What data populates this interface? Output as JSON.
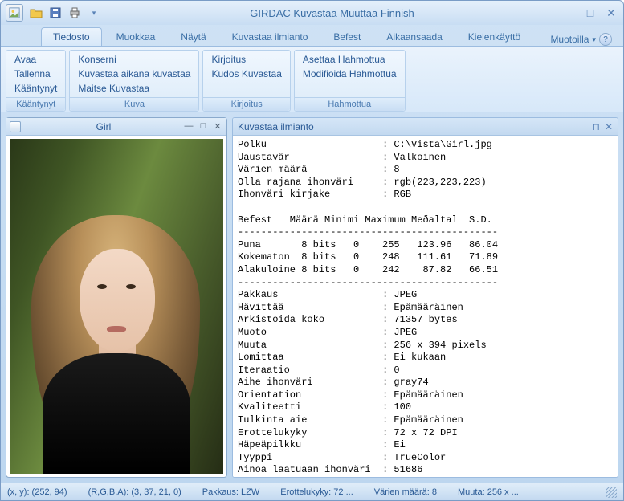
{
  "title": "GIRDAC Kuvastaa Muuttaa Finnish",
  "tabs": {
    "tiedosto": "Tiedosto",
    "muokkaa": "Muokkaa",
    "nayta": "Näytä",
    "kuvastaa_ilmianto": "Kuvastaa ilmianto",
    "befest": "Befest",
    "aikaansaada": "Aikaansaada",
    "kielenkaytto": "Kielenkäyttö",
    "muotoilla": "Muotoilla"
  },
  "ribbon": {
    "group1": {
      "items": [
        "Avaa",
        "Tallenna",
        "Kääntynyt"
      ],
      "label": "Kääntynyt"
    },
    "group2": {
      "items": [
        "Konserni",
        "Kuvastaa aikana kuvastaa",
        "Maitse Kuvastaa"
      ],
      "label": "Kuva"
    },
    "group3": {
      "items": [
        "Kirjoitus",
        "Kudos Kuvastaa"
      ],
      "label": "Kirjoitus"
    },
    "group4": {
      "items": [
        "Asettaa Hahmottua",
        "Modifioida Hahmottua"
      ],
      "label": "Hahmottua"
    }
  },
  "mdi": {
    "title": "Girl"
  },
  "panel": {
    "title": "Kuvastaa ilmianto",
    "text": "Polku                    : C:\\Vista\\Girl.jpg\nUaustavär                : Valkoinen\nVärien määrä             : 8\nOlla rajana ihonväri     : rgb(223,223,223)\nIhonväri kirjake         : RGB\n\nBefest   Määrä Minimi Maximum Meðaltal  S.D.\n---------------------------------------------\nPuna       8 bits   0    255   123.96   86.04\nKokematon  8 bits   0    248   111.61   71.89\nAlakuloine 8 bits   0    242    87.82   66.51\n---------------------------------------------\nPakkaus                  : JPEG\nHävittää                 : Epämääräinen\nArkistoida koko          : 71357 bytes\nMuoto                    : JPEG\nMuuta                    : 256 x 394 pixels\nLomittaa                 : Ei kukaan\nIteraatio                : 0\nAihe ihonväri            : gray74\nOrientation              : Epämääräinen\nKvaliteetti              : 100\nTulkinta aie             : Epämääräinen\nErottelukyky             : 72 x 72 DPI\nHäpeäpilkku              : Ei\nTyyppi                   : TrueColor\nAinoa laatuaan ihonväri  : 51686"
  },
  "status": {
    "xy": "(x, y): (252, 94)",
    "rgba": "(R,G,B,A): (3, 37, 21, 0)",
    "pakkaus": "Pakkaus: LZW",
    "erottelukyky": "Erottelukyky: 72 ...",
    "varien": "Värien määrä: 8",
    "muuta": "Muuta: 256 x ..."
  }
}
